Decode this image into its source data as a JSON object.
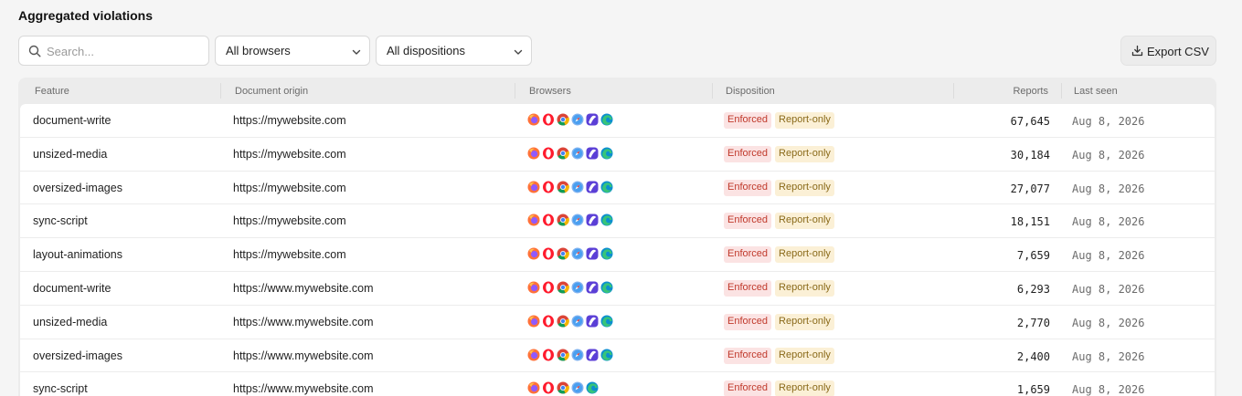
{
  "page": {
    "title": "Aggregated violations"
  },
  "toolbar": {
    "search_placeholder": "Search...",
    "browsers_filter": "All browsers",
    "dispositions_filter": "All dispositions",
    "export_label": "Export CSV"
  },
  "table": {
    "columns": {
      "feature": "Feature",
      "origin": "Document origin",
      "browsers": "Browsers",
      "disposition": "Disposition",
      "reports": "Reports",
      "last_seen": "Last seen"
    },
    "badges": {
      "enforced": "Enforced",
      "report_only": "Report-only"
    },
    "rows": [
      {
        "feature": "document-write",
        "origin": "https://mywebsite.com",
        "browsers": [
          "firefox",
          "opera",
          "chrome",
          "safari",
          "arc",
          "edge"
        ],
        "reports": "67,645",
        "last_seen": "Aug 8, 2026"
      },
      {
        "feature": "unsized-media",
        "origin": "https://mywebsite.com",
        "browsers": [
          "firefox",
          "opera",
          "chrome",
          "safari",
          "arc",
          "edge"
        ],
        "reports": "30,184",
        "last_seen": "Aug 8, 2026"
      },
      {
        "feature": "oversized-images",
        "origin": "https://mywebsite.com",
        "browsers": [
          "firefox",
          "opera",
          "chrome",
          "safari",
          "arc",
          "edge"
        ],
        "reports": "27,077",
        "last_seen": "Aug 8, 2026"
      },
      {
        "feature": "sync-script",
        "origin": "https://mywebsite.com",
        "browsers": [
          "firefox",
          "opera",
          "chrome",
          "safari",
          "arc",
          "edge"
        ],
        "reports": "18,151",
        "last_seen": "Aug 8, 2026"
      },
      {
        "feature": "layout-animations",
        "origin": "https://mywebsite.com",
        "browsers": [
          "firefox",
          "opera",
          "chrome",
          "safari",
          "arc",
          "edge"
        ],
        "reports": "7,659",
        "last_seen": "Aug 8, 2026"
      },
      {
        "feature": "document-write",
        "origin": "https://www.mywebsite.com",
        "browsers": [
          "firefox",
          "opera",
          "chrome",
          "safari",
          "arc",
          "edge"
        ],
        "reports": "6,293",
        "last_seen": "Aug 8, 2026"
      },
      {
        "feature": "unsized-media",
        "origin": "https://www.mywebsite.com",
        "browsers": [
          "firefox",
          "opera",
          "chrome",
          "safari",
          "arc",
          "edge"
        ],
        "reports": "2,770",
        "last_seen": "Aug 8, 2026"
      },
      {
        "feature": "oversized-images",
        "origin": "https://www.mywebsite.com",
        "browsers": [
          "firefox",
          "opera",
          "chrome",
          "safari",
          "arc",
          "edge"
        ],
        "reports": "2,400",
        "last_seen": "Aug 8, 2026"
      },
      {
        "feature": "sync-script",
        "origin": "https://www.mywebsite.com",
        "browsers": [
          "firefox",
          "opera",
          "chrome",
          "safari",
          "edge"
        ],
        "reports": "1,659",
        "last_seen": "Aug 8, 2026"
      }
    ]
  },
  "colors": {
    "enforced_bg": "#fbe3e3",
    "enforced_text": "#c0392b",
    "report_only_bg": "#fbf0d6",
    "report_only_text": "#8a6a1a"
  }
}
